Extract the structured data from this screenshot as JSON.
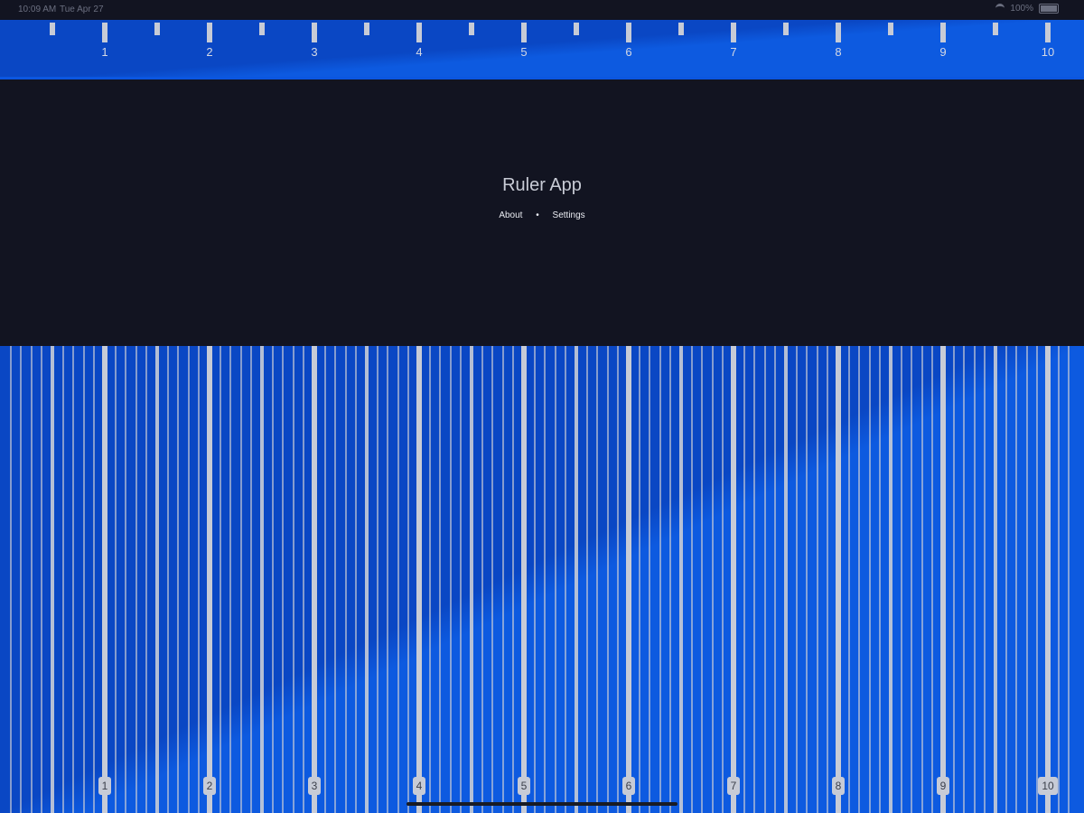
{
  "status_bar": {
    "time": "10:09 AM",
    "date": "Tue Apr 27",
    "battery": "100%"
  },
  "app": {
    "title": "Ruler App",
    "links": [
      {
        "id": "about",
        "label": "About"
      },
      {
        "id": "settings",
        "label": "Settings"
      }
    ],
    "separator": "•"
  },
  "ruler": {
    "labels": [
      "1",
      "2",
      "3",
      "4",
      "5",
      "6",
      "7",
      "8",
      "9",
      "10"
    ],
    "colors": {
      "ruler_blue": "#0a47c4",
      "ruler_blue_light": "#0d5ae0",
      "tick": "#c7cbd6",
      "background": "#121421"
    }
  }
}
